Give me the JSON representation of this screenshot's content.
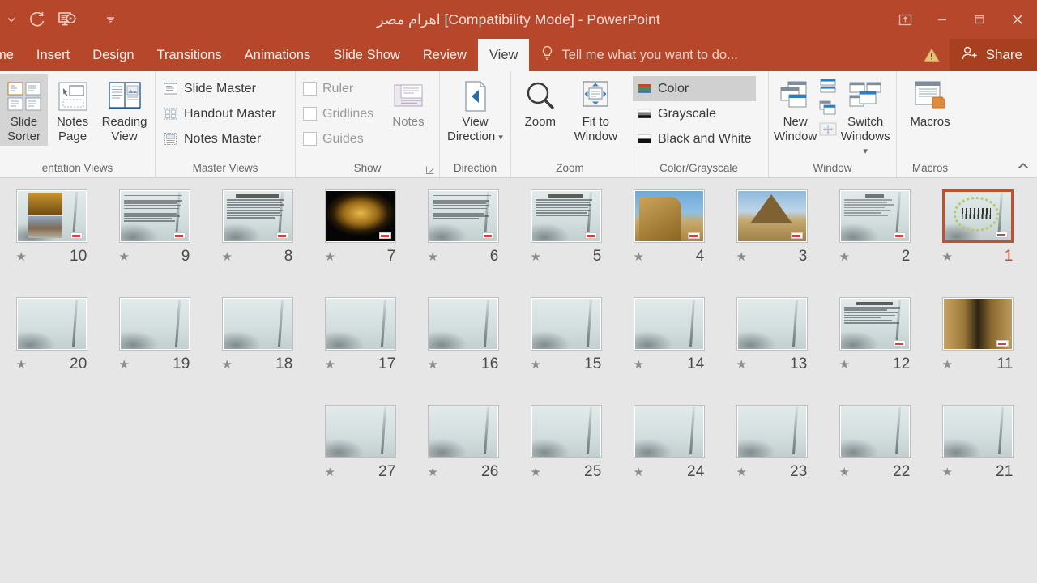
{
  "window": {
    "title": "اهرام مصر [Compatibility Mode] - PowerPoint",
    "quick_access": [
      {
        "name": "redo",
        "glyph": "redo-icon"
      },
      {
        "name": "start-slideshow",
        "glyph": "slideshow-icon"
      },
      {
        "name": "customize-quick-access-toolbar",
        "glyph": "chevron-down-icon"
      }
    ],
    "controls": [
      {
        "name": "ribbon-display-options",
        "label": "Ribbon Display Options"
      },
      {
        "name": "minimize",
        "label": "Minimize"
      },
      {
        "name": "restore",
        "label": "Restore Down"
      },
      {
        "name": "close",
        "label": "Close"
      }
    ]
  },
  "tabs": [
    {
      "label": "me",
      "active": false
    },
    {
      "label": "Insert",
      "active": false
    },
    {
      "label": "Design",
      "active": false
    },
    {
      "label": "Transitions",
      "active": false
    },
    {
      "label": "Animations",
      "active": false
    },
    {
      "label": "Slide Show",
      "active": false
    },
    {
      "label": "Review",
      "active": false
    },
    {
      "label": "View",
      "active": true
    }
  ],
  "tellme": {
    "placeholder": "Tell me what you want to do..."
  },
  "share": {
    "label": "Share"
  },
  "ribbon": {
    "groups": [
      {
        "name": "presentation-views",
        "label": "entation Views",
        "buttons": [
          {
            "label_line1": "Slide",
            "label_line2": "Sorter",
            "selected": true,
            "icon": "slide-sorter-icon"
          },
          {
            "label_line1": "Notes",
            "label_line2": "Page",
            "selected": false,
            "icon": "notes-page-icon"
          },
          {
            "label_line1": "Reading",
            "label_line2": "View",
            "selected": false,
            "icon": "reading-view-icon"
          }
        ]
      },
      {
        "name": "master-views",
        "label": "Master Views",
        "items": [
          {
            "label": "Slide Master",
            "icon": "slide-master-icon"
          },
          {
            "label": "Handout Master",
            "icon": "handout-master-icon"
          },
          {
            "label": "Notes Master",
            "icon": "notes-master-icon"
          }
        ]
      },
      {
        "name": "show",
        "label": "Show",
        "checkboxes": [
          {
            "label": "Ruler",
            "checked": false
          },
          {
            "label": "Gridlines",
            "checked": false
          },
          {
            "label": "Guides",
            "checked": false
          }
        ],
        "notes_button": {
          "label": "Notes",
          "icon": "notes-icon"
        },
        "has_dialog_launcher": true
      },
      {
        "name": "direction",
        "label": "Direction",
        "button": {
          "label_line1": "View",
          "label_line2": "Direction",
          "has_dropdown": true,
          "icon": "view-direction-icon"
        }
      },
      {
        "name": "zoom",
        "label": "Zoom",
        "buttons": [
          {
            "label_line1": "Zoom",
            "label_line2": "",
            "icon": "magnifier-icon"
          },
          {
            "label_line1": "Fit to",
            "label_line2": "Window",
            "icon": "fit-to-window-icon"
          }
        ]
      },
      {
        "name": "color-grayscale",
        "label": "Color/Grayscale",
        "items": [
          {
            "label": "Color",
            "selected": true,
            "icon": "color-swatch-icon"
          },
          {
            "label": "Grayscale",
            "selected": false,
            "icon": "grayscale-swatch-icon"
          },
          {
            "label": "Black and White",
            "selected": false,
            "icon": "blackwhite-swatch-icon"
          }
        ]
      },
      {
        "name": "window",
        "label": "Window",
        "new_window": {
          "label_line1": "New",
          "label_line2": "Window",
          "icon": "new-window-icon"
        },
        "small_items": [
          {
            "name": "arrange-all",
            "icon": "arrange-all-icon"
          },
          {
            "name": "cascade",
            "icon": "cascade-icon"
          },
          {
            "name": "move-split",
            "icon": "move-split-icon"
          }
        ],
        "switch_windows": {
          "label_line1": "Switch",
          "label_line2": "Windows",
          "has_dropdown": true,
          "icon": "switch-windows-icon"
        }
      },
      {
        "name": "macros",
        "label": "Macros",
        "button": {
          "label_line1": "Macros",
          "label_line2": "",
          "icon": "macros-icon"
        }
      }
    ],
    "collapse": {
      "name": "collapse-ribbon",
      "glyph": "chevron-up-icon"
    }
  },
  "sorter": {
    "transition_star": "★",
    "rows": [
      {
        "cells": [
          {
            "number": "10",
            "selected": false,
            "kind": "photo-pair"
          },
          {
            "number": "9",
            "selected": false,
            "kind": "text-plain"
          },
          {
            "number": "8",
            "selected": false,
            "kind": "text-title"
          },
          {
            "number": "7",
            "selected": false,
            "kind": "photo-mask"
          },
          {
            "number": "6",
            "selected": false,
            "kind": "text-plain"
          },
          {
            "number": "5",
            "selected": false,
            "kind": "text-title"
          },
          {
            "number": "4",
            "selected": false,
            "kind": "photo-sphinx"
          },
          {
            "number": "3",
            "selected": false,
            "kind": "photo-pyramid"
          },
          {
            "number": "2",
            "selected": false,
            "kind": "text-sparse"
          },
          {
            "number": "1",
            "selected": true,
            "kind": "calligraphy"
          }
        ]
      },
      {
        "cells": [
          {
            "number": "20",
            "selected": false,
            "kind": "blank"
          },
          {
            "number": "19",
            "selected": false,
            "kind": "blank"
          },
          {
            "number": "18",
            "selected": false,
            "kind": "blank"
          },
          {
            "number": "17",
            "selected": false,
            "kind": "blank"
          },
          {
            "number": "16",
            "selected": false,
            "kind": "blank"
          },
          {
            "number": "15",
            "selected": false,
            "kind": "blank"
          },
          {
            "number": "14",
            "selected": false,
            "kind": "blank"
          },
          {
            "number": "13",
            "selected": false,
            "kind": "blank"
          },
          {
            "number": "12",
            "selected": false,
            "kind": "text-title"
          },
          {
            "number": "11",
            "selected": false,
            "kind": "photo-corridor"
          }
        ]
      },
      {
        "cells": [
          {
            "number": "",
            "selected": false,
            "kind": "spacer"
          },
          {
            "number": "",
            "selected": false,
            "kind": "spacer"
          },
          {
            "number": "",
            "selected": false,
            "kind": "spacer"
          },
          {
            "number": "27",
            "selected": false,
            "kind": "blank"
          },
          {
            "number": "26",
            "selected": false,
            "kind": "blank"
          },
          {
            "number": "25",
            "selected": false,
            "kind": "blank"
          },
          {
            "number": "24",
            "selected": false,
            "kind": "blank"
          },
          {
            "number": "23",
            "selected": false,
            "kind": "blank"
          },
          {
            "number": "22",
            "selected": false,
            "kind": "blank"
          },
          {
            "number": "21",
            "selected": false,
            "kind": "blank"
          }
        ]
      }
    ]
  },
  "colors": {
    "brand": "#B7472A",
    "share": "#A8401F",
    "selection": "#C0502E",
    "ribbon_bg": "#F5F5F5",
    "canvas_bg": "#E6E6E6"
  }
}
